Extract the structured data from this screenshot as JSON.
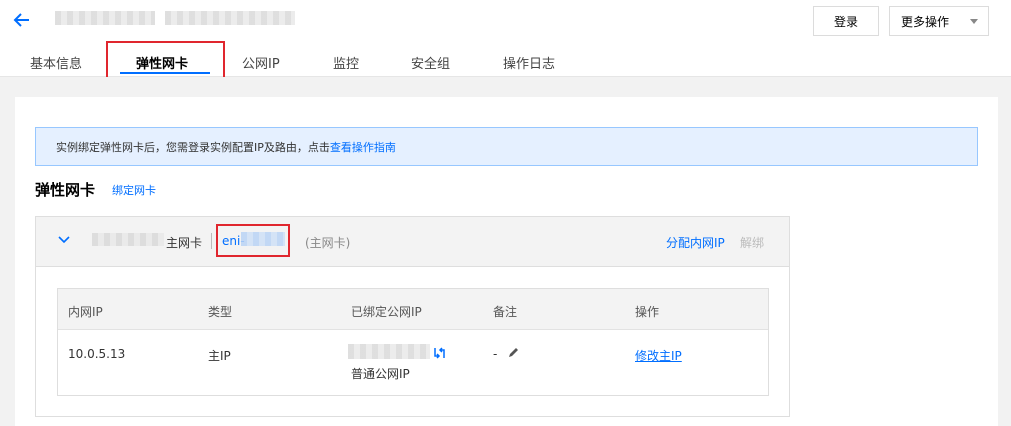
{
  "header": {
    "login_label": "登录",
    "more_actions_label": "更多操作"
  },
  "tabs": [
    {
      "label": "基本信息"
    },
    {
      "label": "弹性网卡"
    },
    {
      "label": "公网IP"
    },
    {
      "label": "监控"
    },
    {
      "label": "安全组"
    },
    {
      "label": "操作日志"
    }
  ],
  "notice": {
    "text": "实例绑定弹性网卡后，您需登录实例配置IP及路由，点击 ",
    "link": "查看操作指南"
  },
  "section": {
    "title": "弹性网卡",
    "bind_link": "绑定网卡"
  },
  "eni": {
    "primary_label": "主网卡",
    "id_prefix": "eni-",
    "tag": "(主网卡)",
    "assign_ip": "分配内网IP",
    "unbind": "解绑"
  },
  "table": {
    "columns": [
      "内网IP",
      "类型",
      "已绑定公网IP",
      "备注",
      "操作"
    ],
    "rows": [
      {
        "private_ip": "10.0.5.13",
        "type": "主IP",
        "public_ip_type": "普通公网IP",
        "note": "-",
        "action": "修改主IP"
      }
    ]
  },
  "colors": {
    "accent": "#006eff",
    "highlight_box": "#e0262e",
    "notice_bg": "#e5f0ff"
  }
}
